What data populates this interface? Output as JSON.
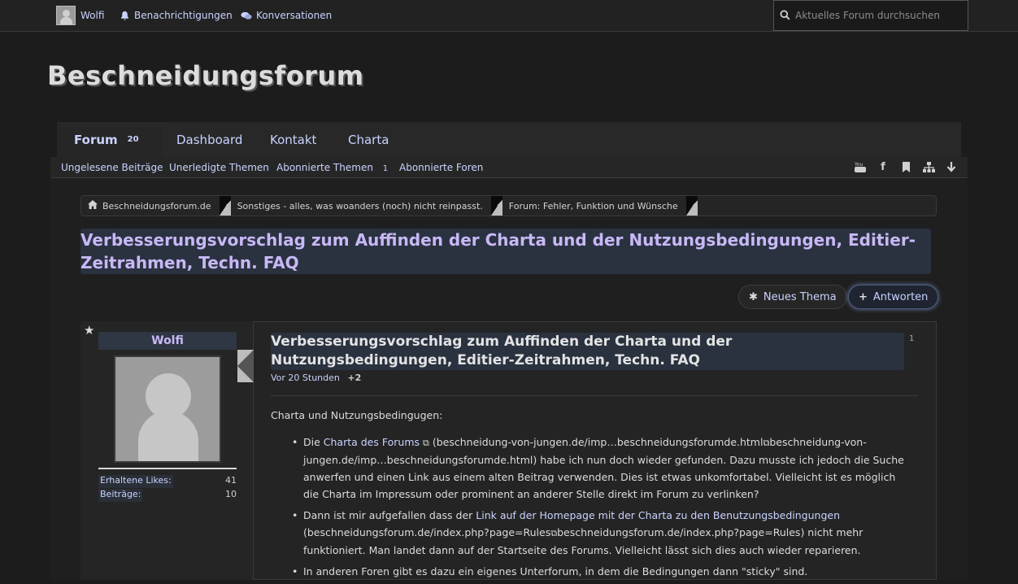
{
  "topbar": {
    "username": "Wolfi",
    "notifications": "Benachrichtigungen",
    "conversations": "Konversationen",
    "search_placeholder": "Aktuelles Forum durchsuchen"
  },
  "logo": "Beschneidungsforum",
  "nav": {
    "tabs": [
      {
        "label": "Forum",
        "count": "20"
      },
      {
        "label": "Dashboard"
      },
      {
        "label": "Kontakt"
      },
      {
        "label": "Charta"
      }
    ],
    "subnav": [
      {
        "label": "Ungelesene Beiträge"
      },
      {
        "label": "Unerledigte Themen"
      },
      {
        "label": "Abonnierte Themen",
        "count": "1"
      },
      {
        "label": "Abonnierte Foren"
      }
    ]
  },
  "breadcrumb": [
    "Beschneidungsforum.de",
    "Sonstiges - alles, was woanders (noch) nicht reinpasst.",
    "Forum: Fehler, Funktion und Wünsche"
  ],
  "thread": {
    "title": "Verbesserungsvorschlag zum Auffinden der Charta und der Nutzungsbedingungen, Editier-Zeitrahmen, Techn. FAQ",
    "new_thread_label": "Neues Thema",
    "reply_label": "Antworten"
  },
  "post": {
    "author": "Wolfi",
    "likes_label": "Erhaltene Likes:",
    "likes_value": "41",
    "posts_label": "Beiträge:",
    "posts_value": "10",
    "title": "Verbesserungsvorschlag zum Auffinden der Charta und der Nutzungsbedingungen, Editier-Zeitrahmen, Techn. FAQ",
    "number": "1",
    "time": "Vor 20 Stunden",
    "plus": "+2",
    "intro": "Charta und Nutzungsbedingugen:",
    "b1_pre": "Die ",
    "b1_link": "Charta des Forums",
    "b1_mid": " (beschneidung-von-jungen.de/imp…beschneidungsforumde.html",
    "b1_mid2": "beschneidung-von-jungen.de/imp…beschneidungsforumde.html",
    "b1_post": ") habe ich nun doch wieder gefunden. Dazu musste ich jedoch die Suche anwerfen und einen Link aus einem alten Beitrag verwenden. Dies ist etwas unkomfortabel. Vielleicht ist es möglich die Charta im Impressum oder prominent an anderer Stelle direkt im Forum zu verlinken?",
    "b2_pre": "Dann ist mir aufgefallen dass der ",
    "b2_link": "Link auf der Homepage mit der Charta zu den Benutzungsbedingungen",
    "b2_mid": " (beschneidungsforum.de/index.php?page=Rules",
    "b2_mid2": "beschneidungsforum.de/index.php?page=Rules",
    "b2_post": ") nicht mehr funktioniert. Man landet dann auf der Startseite des Forums. Vielleicht lässt sich dies auch wieder reparieren.",
    "b3": "In anderen Foren gibt es dazu ein eigenes Unterforum, in dem die Bedingungen dann \"sticky\" sind."
  }
}
